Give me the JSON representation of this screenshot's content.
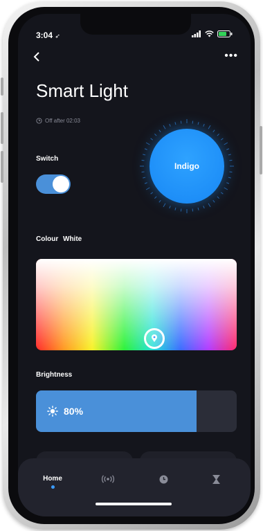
{
  "status_bar": {
    "time": "3:04"
  },
  "header": {
    "title": "Smart Light",
    "timer": "Off after 02:03"
  },
  "switch": {
    "label": "Switch",
    "on": true
  },
  "colour": {
    "current_name": "Indigo",
    "current_hex": "#1e8ff8",
    "section_label": "Colour",
    "mode_label": "White"
  },
  "brightness": {
    "label": "Brightness",
    "value_text": "80%",
    "value": 0.8
  },
  "tabs": [
    {
      "label": "Home",
      "icon": "home",
      "active": true
    },
    {
      "icon": "broadcast-icon",
      "active": false
    },
    {
      "icon": "clock-icon",
      "active": false
    },
    {
      "icon": "hourglass-icon",
      "active": false
    }
  ],
  "colors": {
    "accent": "#4a90d9",
    "background": "#14151c",
    "tabbar": "#22232d"
  }
}
